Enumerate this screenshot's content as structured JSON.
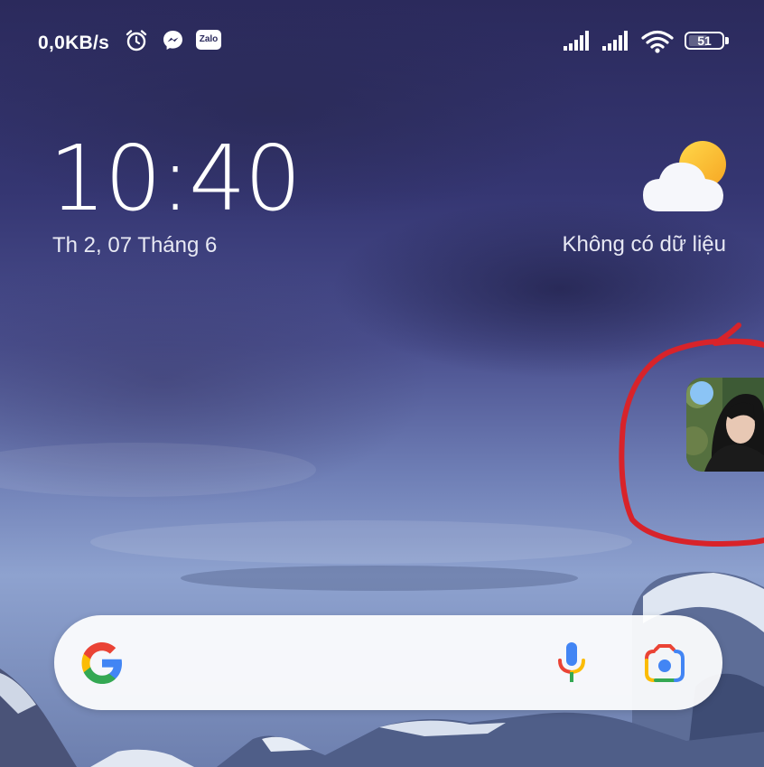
{
  "status_bar": {
    "net_speed": "0,0KB/s",
    "notification_icons": [
      "alarm-icon",
      "messenger-icon",
      "zalo-icon"
    ],
    "zalo_label": "Zalo",
    "signal_icons": [
      "signal-sim1-icon",
      "signal-sim2-icon",
      "wifi-icon"
    ],
    "battery_percent": "51"
  },
  "clock": {
    "time": "10:40",
    "date": "Th 2, 07 Tháng 6"
  },
  "weather": {
    "icon": "partly-cloudy-icon",
    "text": "Không có dữ liệu"
  },
  "chat_head": {
    "icon": "chat-head-avatar",
    "annotation_color": "#d8232a"
  },
  "search_bar": {
    "icons": [
      "google-g-icon",
      "microphone-icon",
      "google-lens-icon"
    ]
  },
  "colors": {
    "google_blue": "#4285F4",
    "google_red": "#EA4335",
    "google_yellow": "#FBBC05",
    "google_green": "#34A853"
  }
}
